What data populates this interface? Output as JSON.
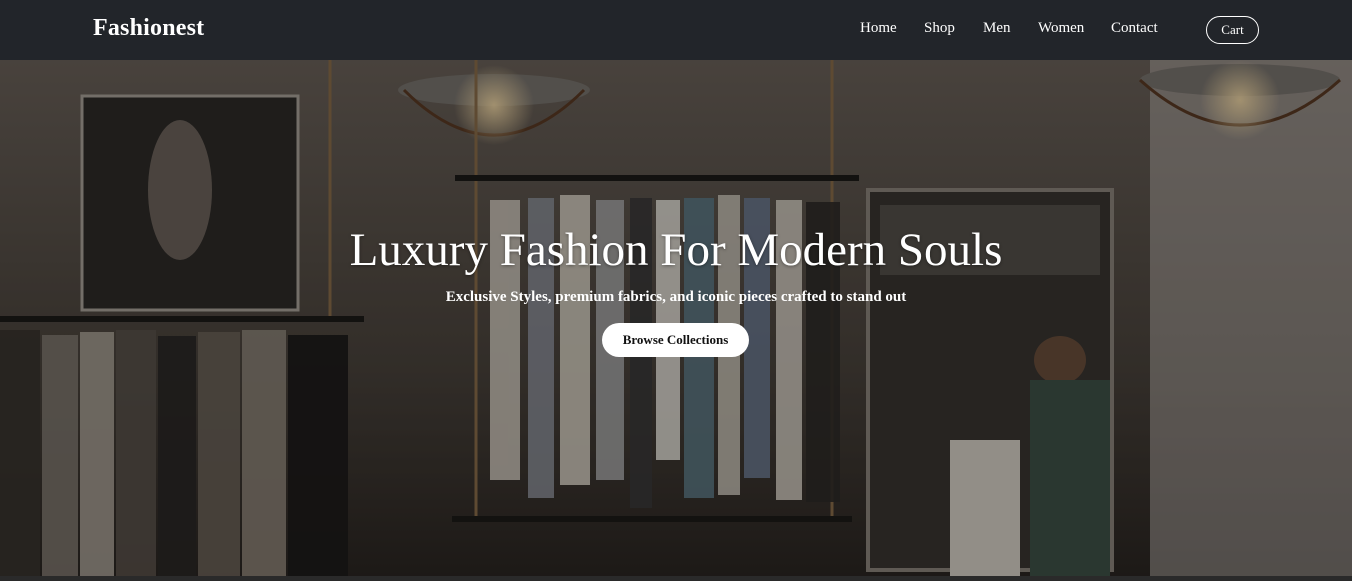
{
  "brand": {
    "name": "Fashionest"
  },
  "nav": {
    "links": [
      "Home",
      "Shop",
      "Men",
      "Women",
      "Contact"
    ],
    "cart_label": "Cart"
  },
  "hero": {
    "title": "Luxury Fashion For Modern Souls",
    "subtitle": "Exclusive Styles, premium fabrics, and iconic pieces crafted to stand out",
    "cta_label": "Browse Collections",
    "image_description_icon": "store-interior-photo"
  },
  "colors": {
    "navbar_bg": "#22252a",
    "text": "#ffffff",
    "cta_bg": "#ffffff",
    "cta_text": "#111111"
  }
}
